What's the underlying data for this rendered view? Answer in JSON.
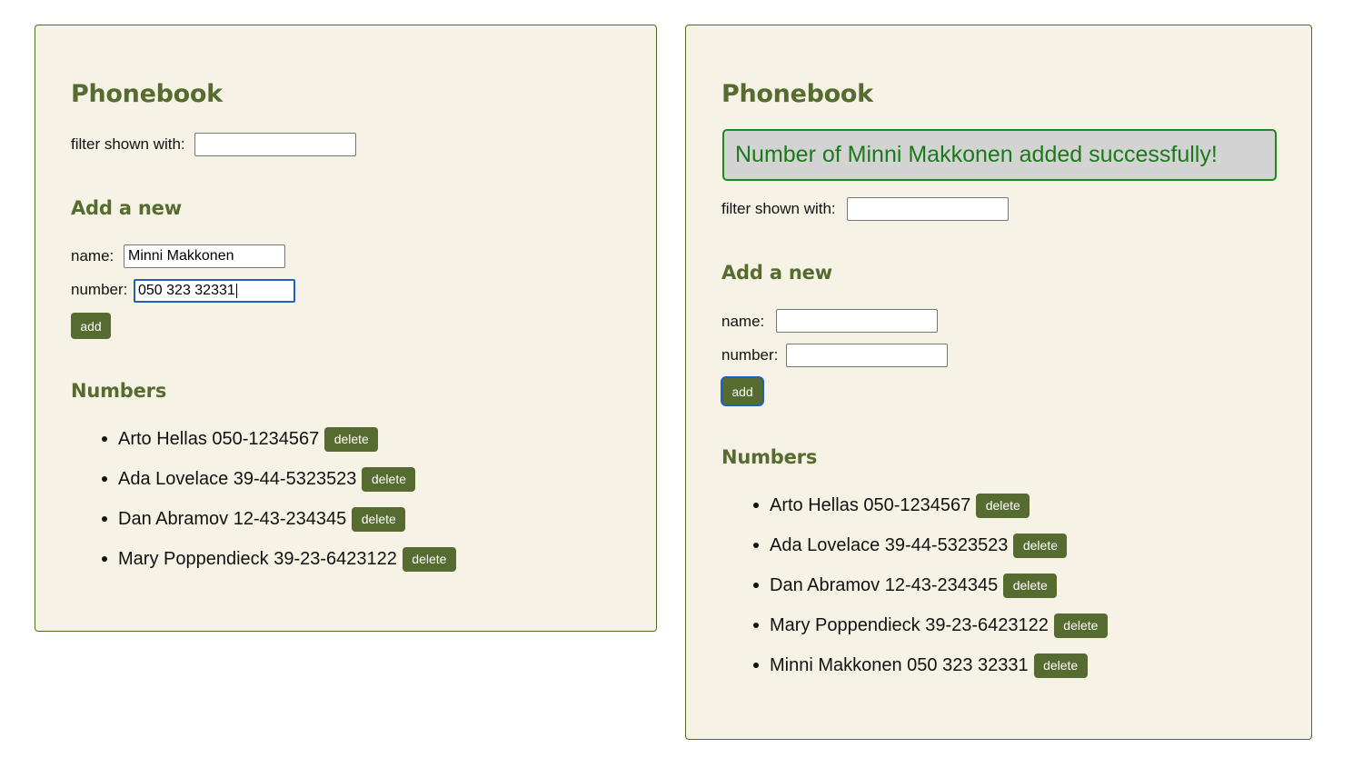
{
  "left": {
    "title": "Phonebook",
    "filter": {
      "label": "filter shown with:",
      "value": ""
    },
    "form": {
      "heading": "Add a new",
      "name_label": "name:",
      "name_value": "Minni Makkonen",
      "number_label": "number:",
      "number_value": "050 323 32331",
      "add_label": "add"
    },
    "numbers_heading": "Numbers",
    "persons": [
      {
        "text": "Arto Hellas 050-1234567",
        "delete_label": "delete"
      },
      {
        "text": "Ada Lovelace 39-44-5323523",
        "delete_label": "delete"
      },
      {
        "text": "Dan Abramov 12-43-234345",
        "delete_label": "delete"
      },
      {
        "text": "Mary Poppendieck 39-23-6423122",
        "delete_label": "delete"
      }
    ]
  },
  "right": {
    "title": "Phonebook",
    "notification": "Number of Minni Makkonen added successfully!",
    "filter": {
      "label": "filter shown with:",
      "value": ""
    },
    "form": {
      "heading": "Add a new",
      "name_label": "name:",
      "name_value": "",
      "number_label": "number:",
      "number_value": "",
      "add_label": "add"
    },
    "numbers_heading": "Numbers",
    "persons": [
      {
        "text": "Arto Hellas 050-1234567",
        "delete_label": "delete"
      },
      {
        "text": "Ada Lovelace 39-44-5323523",
        "delete_label": "delete"
      },
      {
        "text": "Dan Abramov 12-43-234345",
        "delete_label": "delete"
      },
      {
        "text": "Mary Poppendieck 39-23-6423122",
        "delete_label": "delete"
      },
      {
        "text": "Minni Makkonen 050 323 32331",
        "delete_label": "delete"
      }
    ]
  },
  "colors": {
    "panel_bg": "#f7f2e6",
    "accent": "#556b2f",
    "notification_text": "#1a7a1a",
    "notification_border": "#1b8a1b",
    "notification_bg": "#d3d3d3",
    "focus_ring": "#2060c0"
  }
}
